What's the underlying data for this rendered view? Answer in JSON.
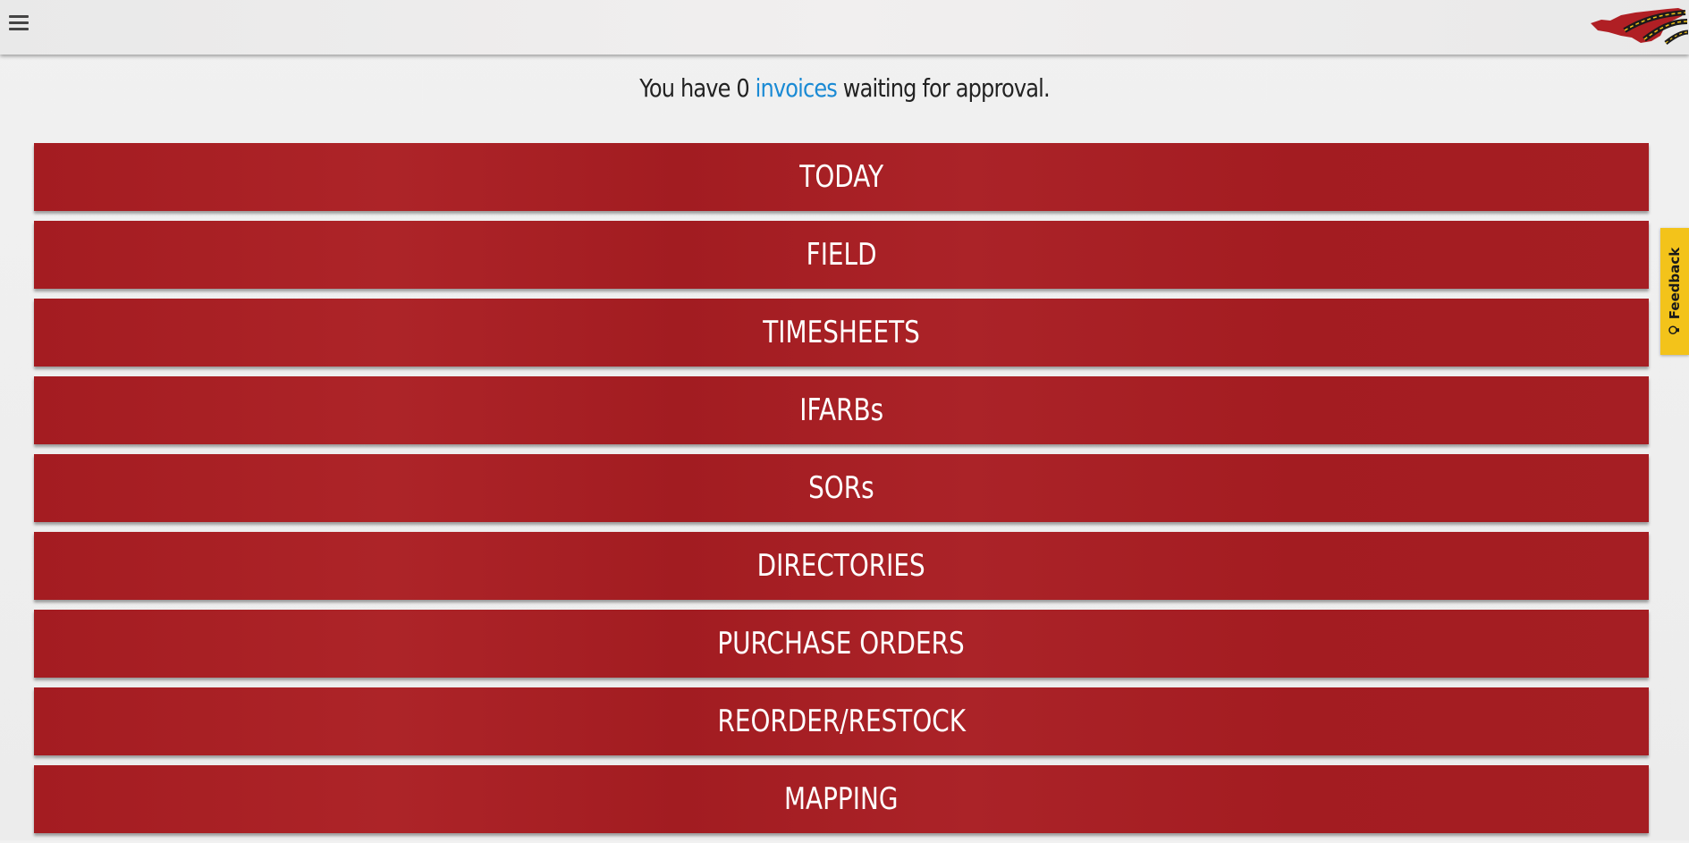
{
  "header": {
    "menu_icon": "hamburger-menu-icon",
    "logo_icon": "company-logo"
  },
  "notice": {
    "prefix": "You have 0 ",
    "link": "invoices",
    "suffix": " waiting for approval."
  },
  "nav": {
    "items": [
      {
        "label": "TODAY"
      },
      {
        "label": "FIELD"
      },
      {
        "label": "TIMESHEETS"
      },
      {
        "label": "IFARBs"
      },
      {
        "label": "SORs"
      },
      {
        "label": "DIRECTORIES"
      },
      {
        "label": "PURCHASE ORDERS"
      },
      {
        "label": "REORDER/RESTOCK"
      },
      {
        "label": "MAPPING"
      }
    ]
  },
  "feedback": {
    "label": "Feedback",
    "icon": "lightbulb-icon"
  },
  "colors": {
    "button_red": "#a51e23",
    "link_blue": "#1a8ad4",
    "feedback_yellow": "#f3c31a"
  }
}
